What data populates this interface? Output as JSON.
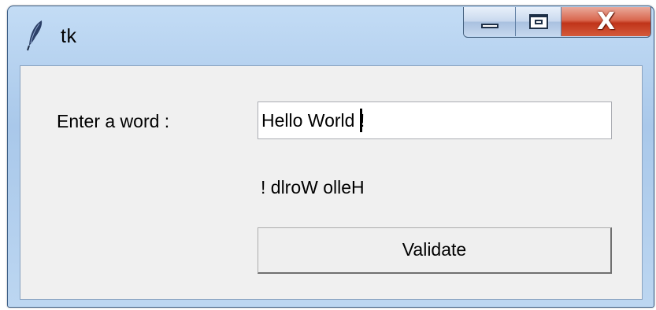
{
  "window": {
    "title": "tk",
    "icon": "tk-feather-icon",
    "controls": {
      "minimize": "minimize-icon",
      "maximize": "maximize-icon",
      "close_label": "X"
    }
  },
  "form": {
    "prompt_label": "Enter a word :",
    "input_value": "Hello World !",
    "result_text": "! dlroW olleH",
    "validate_label": "Validate"
  },
  "colors": {
    "titlebar": "#b6d1ef",
    "client_background": "#f0f0f0",
    "close_button": "#c7442a"
  }
}
